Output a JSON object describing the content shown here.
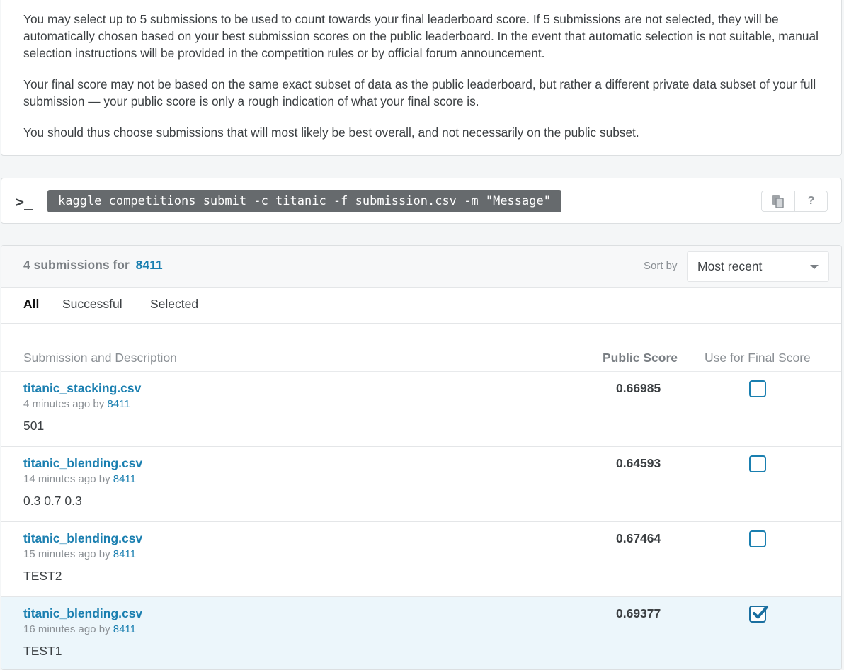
{
  "info": {
    "paragraphs": [
      "You may select up to 5 submissions to be used to count towards your final leaderboard score. If 5 submissions are not selected, they will be automatically chosen based on your best submission scores on the public leaderboard. In the event that automatic selection is not suitable, manual selection instructions will be provided in the competition rules or by official forum announcement.",
      "Your final score may not be based on the same exact subset of data as the public leaderboard, but rather a different private data subset of your full submission — your public score is only a rough indication of what your final score is.",
      "You should thus choose submissions that will most likely be best overall, and not necessarily on the public subset."
    ]
  },
  "command": {
    "prompt_icon": "terminal-prompt-icon",
    "text": "kaggle competitions submit -c titanic -f submission.csv -m \"Message\"",
    "copy_icon": "copy-icon",
    "help_label": "?"
  },
  "submissions": {
    "count_text": "4 submissions for",
    "team": "8411",
    "sort_label": "Sort by",
    "sort_value": "Most recent",
    "tabs": [
      "All",
      "Successful",
      "Selected"
    ],
    "active_tab": "All",
    "columns": {
      "description": "Submission and Description",
      "public_score": "Public Score",
      "final": "Use for Final Score"
    },
    "rows": [
      {
        "file": "titanic_stacking.csv",
        "time": "4 minutes ago by",
        "user": "8411",
        "description": "501",
        "score": "0.66985",
        "selected": false
      },
      {
        "file": "titanic_blending.csv",
        "time": "14 minutes ago by",
        "user": "8411",
        "description": "0.3 0.7 0.3",
        "score": "0.64593",
        "selected": false
      },
      {
        "file": "titanic_blending.csv",
        "time": "15 minutes ago by",
        "user": "8411",
        "description": "TEST2",
        "score": "0.67464",
        "selected": false
      },
      {
        "file": "titanic_blending.csv",
        "time": "16 minutes ago by",
        "user": "8411",
        "description": "TEST1",
        "score": "0.69377",
        "selected": true
      }
    ]
  },
  "colors": {
    "link": "#1a7fb0",
    "selected_row_bg": "#ecf6fb",
    "command_bg": "#666a6d"
  }
}
